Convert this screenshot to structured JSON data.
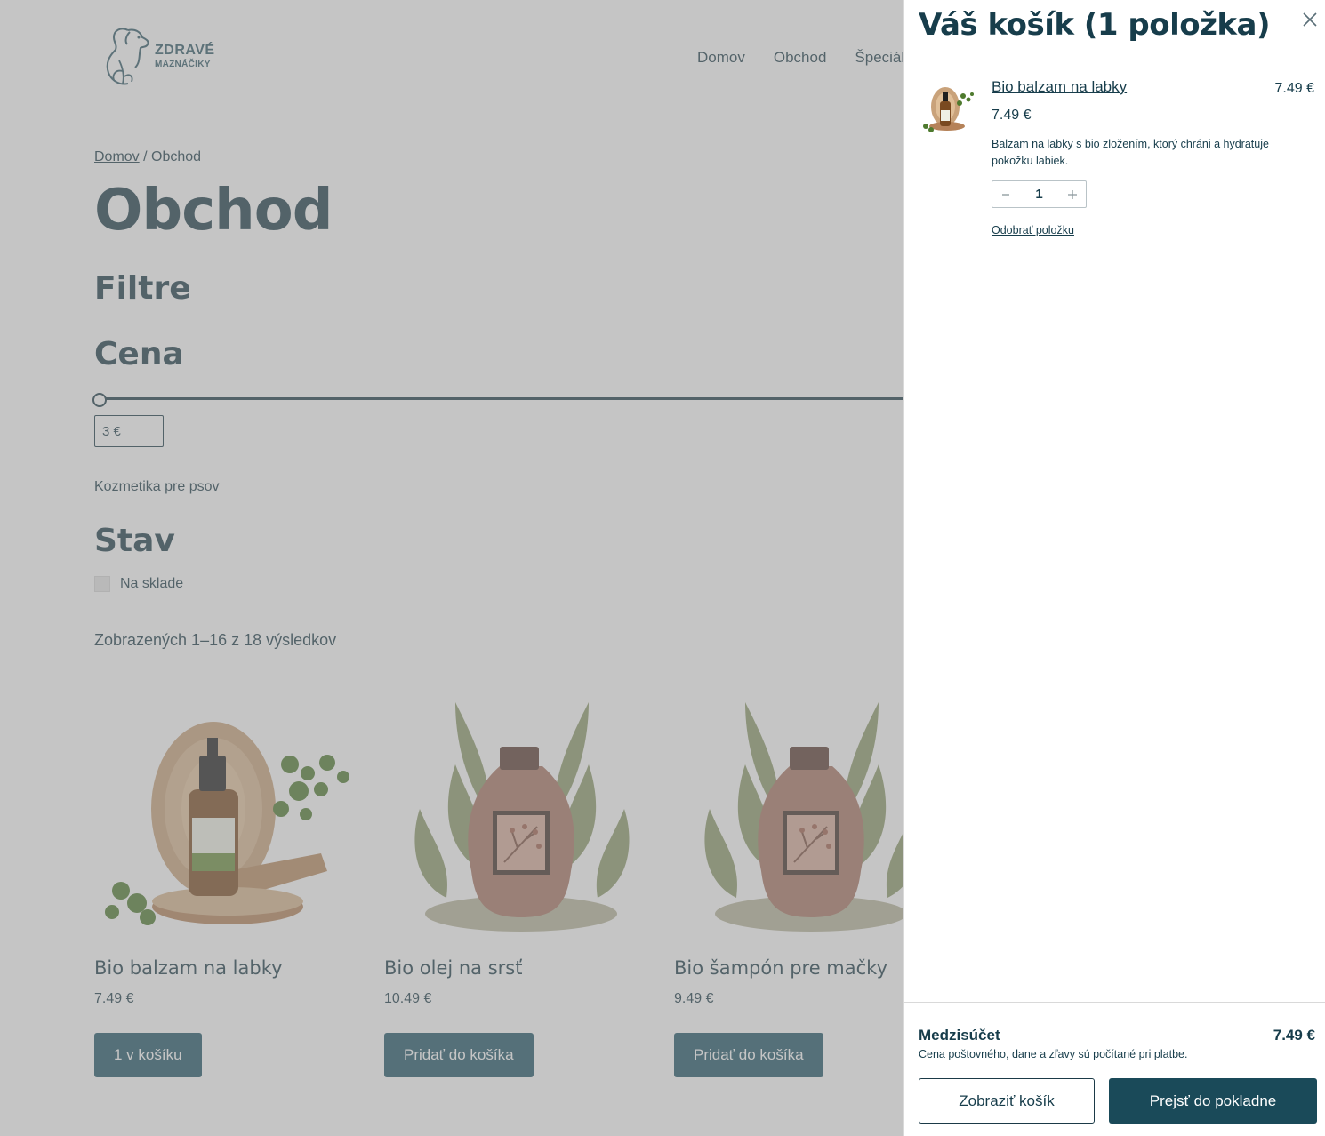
{
  "brand": {
    "line1": "ZDRAVÉ",
    "line2": "MAZNÁČIKY"
  },
  "nav": {
    "items": [
      "Domov",
      "Obchod",
      "Špeciál"
    ]
  },
  "breadcrumb": {
    "home": "Domov",
    "separator": " / ",
    "current": "Obchod"
  },
  "page_title": "Obchod",
  "filters": {
    "title": "Filtre",
    "price_title": "Cena",
    "price_min": "3 €",
    "category": "Kozmetika pre psov",
    "status_title": "Stav",
    "in_stock_label": "Na sklade"
  },
  "results_count": "Zobrazených 1–16 z 18 výsledkov",
  "products": [
    {
      "name": "Bio balzam na labky",
      "price": "7.49 €",
      "button": "1 v košíku"
    },
    {
      "name": "Bio olej na srsť",
      "price": "10.49 €",
      "button": "Pridať do košíka"
    },
    {
      "name": "Bio šampón pre mačky",
      "price": "9.49 €",
      "button": "Pridať do košíka"
    }
  ],
  "cart": {
    "title": "Váš košík (1 položka)",
    "item": {
      "name": "Bio balzam na labky",
      "unit_price": "7.49 €",
      "line_total": "7.49 €",
      "description": "Balzam na labky s bio zložením, ktorý chráni a hydratuje pokožku labiek.",
      "quantity": "1",
      "remove_label": "Odobrať položku"
    },
    "subtotal_label": "Medzisúčet",
    "subtotal_value": "7.49 €",
    "note": "Cena poštovného, dane a zľavy sú počítané pri platbe.",
    "view_cart": "Zobraziť košík",
    "checkout": "Prejsť do pokladne"
  },
  "colors": {
    "primary": "#1a4a59",
    "text": "#173d4b",
    "overlay": "#c6c6c6"
  }
}
